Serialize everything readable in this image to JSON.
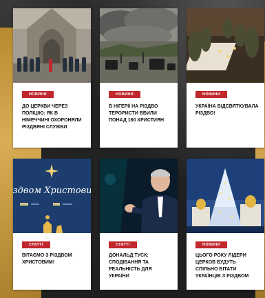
{
  "cards": [
    {
      "category": "НОВИНИ",
      "title": "ДО ЦЕРКВИ ЧЕРЕЗ ПОЛІЦІЮ: ЯК В НІМЕЧЧИНІ ОХОРОНЯЛИ РІЗДВЯНІ СЛУЖБИ"
    },
    {
      "category": "НОВИНИ",
      "title": "В НІГЕРІЇ НА РІЗДВО ТЕРОРИСТИ ВБИЛИ ПОНАД 160 ХРИСТИЯН"
    },
    {
      "category": "НОВИНИ",
      "title": "УКРАЇНА ВІДСВЯТКУВАЛА РІЗДВО!"
    },
    {
      "category": "СТАТТІ",
      "title": "ВІТАЄМО З РІЗДВОМ ХРИСТОВИМ!",
      "image_text": "Різдвом Христовим"
    },
    {
      "category": "СТАТТІ",
      "title": "ДОНАЛЬД ТУСК: СПОДІВАННЯ ТА РЕАЛЬНІСТЬ ДЛЯ УКРАЇНИ"
    },
    {
      "category": "НОВИНИ",
      "title": "ЦЬОГО РОКУ ЛІДЕРИ ЦЕРКОВ БУДУТЬ СПІЛЬНО ВІТАТИ УКРАЇНЦІВ З РІЗДВОМ"
    }
  ],
  "colors": {
    "badge": "#c1272d",
    "gold": "#d8ad55"
  }
}
